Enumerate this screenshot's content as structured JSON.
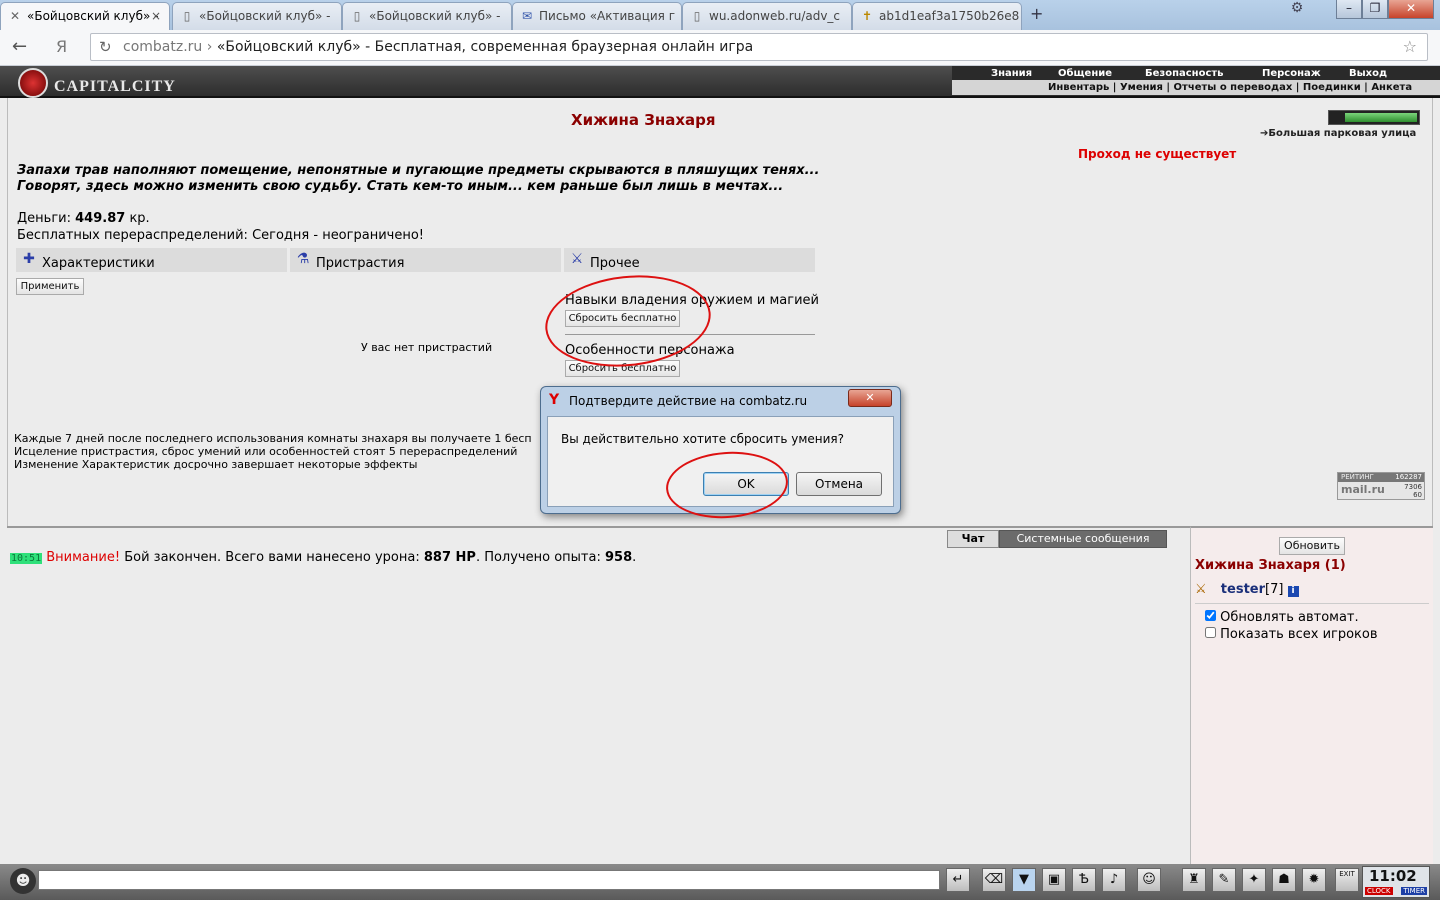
{
  "browser": {
    "tabs": [
      {
        "label": "«Бойцовский клуб» -",
        "icon": "fightclub-icon",
        "active": true
      },
      {
        "label": "«Бойцовский клуб» -",
        "icon": "page-icon",
        "active": false
      },
      {
        "label": "«Бойцовский клуб» -",
        "icon": "page-icon",
        "active": false
      },
      {
        "label": "Письмо «Активация г",
        "icon": "mail-icon",
        "active": false
      },
      {
        "label": "wu.adonweb.ru/adv_c",
        "icon": "page-icon",
        "active": false
      },
      {
        "label": "ab1d1eaf3a1750b26e8",
        "icon": "cross-icon",
        "active": false
      }
    ],
    "new_tab": "+",
    "url_domain": "combatz.ru",
    "url_sep": "›",
    "url_title": "«Бойцовский клуб» - Бесплатная, современная браузерная онлайн игра",
    "yandex_glyph": "Я"
  },
  "game": {
    "logo": "CAPITALCITY",
    "nav_main": [
      "Знания",
      "Общение",
      "Безопасность",
      "Персонаж",
      "Выход"
    ],
    "nav_sub": "Инвентарь | Умения | Отчеты о переводах | Поединки | Анкета",
    "room_title": "Хижина Знахаря",
    "location_link": "Большая парковая улица",
    "no_passage": "Проход не существует",
    "intro_line1": "Запахи трав наполняют помещение, непонятные и пугающие предметы скрываются в пляшущих тенях...",
    "intro_line2": "Говорят, здесь можно изменить свою судьбу. Стать кем-то иным... кем раньше был лишь в мечтах...",
    "money_label": "Деньги:",
    "money_value": "449.87",
    "money_unit": "кр.",
    "free_redistrib": "Бесплатных перераспределений: Сегодня - неограничено!",
    "col_stats": "Характеристики",
    "col_addictions": "Пристрастия",
    "col_other": "Прочее",
    "apply_btn": "Применить",
    "no_addictions": "У вас нет пристрастий",
    "skills_label": "Навыки владения оружием и магией",
    "reset_free_btn": "Сбросить бесплатно",
    "features_label": "Особенности персонажа",
    "reset_free_btn2": "Сбросить бесплатно",
    "note1": "Каждые 7 дней после последнего использования комнаты знахаря вы получаете 1 бесп",
    "note2": "Исцеление пристрастия, сброс умений или особенностей стоят 5 перераспределений",
    "note3": "Изменение Характеристик досрочно завершает некоторые эффекты",
    "rating_label": "РЕЙТИНГ",
    "rating_values": [
      "162287",
      "7306",
      "60"
    ],
    "mailru_logo": "mail.ru"
  },
  "chat": {
    "tabs": [
      "Чат",
      "Системные сообщения"
    ],
    "time": "10:51",
    "warn": "Внимание!",
    "msg_a": "Бой закончен. Всего вами нанесено урона:",
    "damage": "887 HP",
    "msg_b": ". Получено опыта:",
    "exp": "958",
    "msg_end": "."
  },
  "side": {
    "refresh_btn": "Обновить",
    "room_title": "Хижина Знахаря (1)",
    "player_name": "tester",
    "player_level": "[7]",
    "info_icon": "i",
    "auto_refresh": "Обновлять автомат.",
    "show_all": "Показать всех игроков"
  },
  "dialog": {
    "title": "Подтвердите действие на combatz.ru",
    "message": "Вы действительно хотите сбросить умения?",
    "ok": "OK",
    "cancel": "Отмена",
    "close_glyph": "✕"
  },
  "bottom": {
    "clock": "11:02",
    "clock_label": "CLOCK",
    "timer_label": "TIMER",
    "exit_label": "EXIT"
  }
}
